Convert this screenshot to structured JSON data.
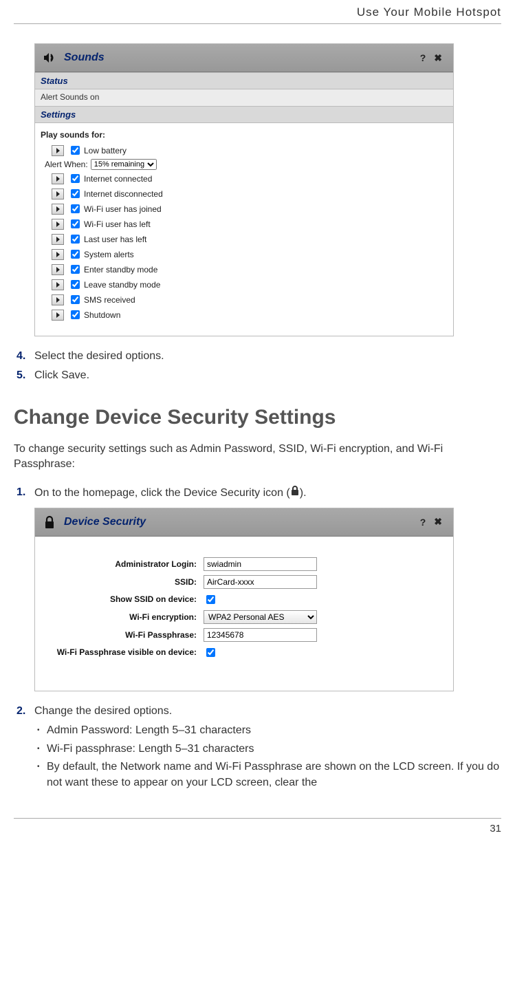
{
  "header": {
    "title": "Use Your Mobile Hotspot"
  },
  "footer": {
    "page_number": "31"
  },
  "sounds_panel": {
    "title": "Sounds",
    "status_hdr": "Status",
    "status_text": "Alert Sounds on",
    "settings_hdr": "Settings",
    "play_label": "Play sounds for:",
    "alert_when_label": "Alert When:",
    "alert_when_value": "15% remaining",
    "items": [
      "Low battery",
      "Internet connected",
      "Internet disconnected",
      "Wi-Fi user has joined",
      "Wi-Fi user has left",
      "Last user has left",
      "System alerts",
      "Enter standby mode",
      "Leave standby mode",
      "SMS received",
      "Shutdown"
    ]
  },
  "steps_a": {
    "n4": "4.",
    "t4": "Select the desired options.",
    "n5": "5.",
    "t5": "Click Save."
  },
  "section_heading": "Change Device Security Settings",
  "intro": "To change security settings such as Admin Password, SSID, Wi-Fi encryption, and Wi-Fi Passphrase:",
  "step1": {
    "n": "1.",
    "pre": "On to the homepage, click the Device Security icon (",
    "post": ")."
  },
  "security_panel": {
    "title": "Device Security",
    "labels": {
      "admin": "Administrator Login:",
      "ssid": "SSID:",
      "show_ssid": "Show SSID on device:",
      "enc": "Wi-Fi encryption:",
      "pass": "Wi-Fi Passphrase:",
      "pass_vis": "Wi-Fi Passphrase visible on device:"
    },
    "values": {
      "admin": "swiadmin",
      "ssid": "AirCard-xxxx",
      "enc": "WPA2 Personal AES",
      "pass": "12345678"
    }
  },
  "step2": {
    "n": "2.",
    "t": "Change the desired options."
  },
  "bullets": {
    "b1": "Admin Password: Length 5–31 characters",
    "b2": "Wi-Fi passphrase: Length 5–31 characters",
    "b3": "By default, the Network name and Wi-Fi Passphrase are shown on the LCD screen. If you do not want these to appear on your LCD screen, clear the"
  }
}
